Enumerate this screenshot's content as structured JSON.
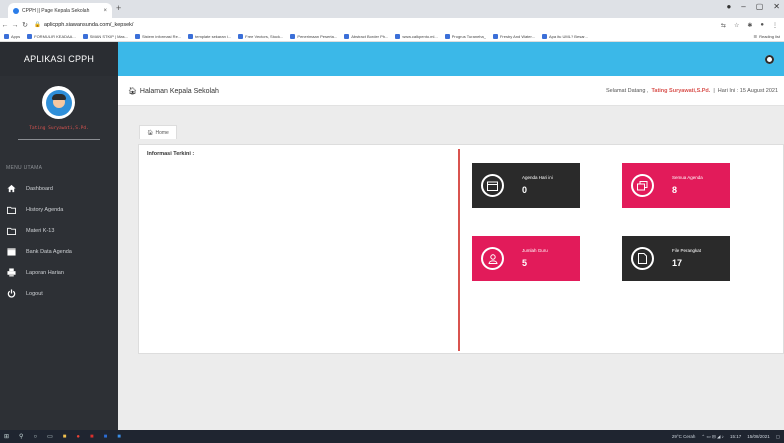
{
  "browser": {
    "tab_title": "CPPH || Page Kepala Sekolah",
    "tab_close": "×",
    "new_tab": "+",
    "url": "aplicpph.siawansunda.com/_kepsek/",
    "bookmarks": [
      "Apps",
      "FORMULIR KEADAA...",
      "SMAN STKIP | Mas...",
      "Sistem informasi Re...",
      "template sekaran i...",
      "Free Vectors, Stock...",
      "Penerimaan Peserta...",
      "Abstract Border Ph...",
      "www.calkpento.ml...",
      "Progrus Turaneha_",
      "Fresby And Water...",
      "Apa itu UML? Besar..."
    ],
    "reading_list": "Reading list"
  },
  "app": {
    "brand": "APLIKASI CPPH",
    "user_name": "Tating Suryawati,S.Pd.",
    "menu_title": "MENU UTAMA",
    "menu": [
      {
        "label": "Dashboard",
        "icon": "home-icon"
      },
      {
        "label": "History Agenda",
        "icon": "folder-icon"
      },
      {
        "label": "Materi K-13",
        "icon": "folder-icon"
      },
      {
        "label": "Bank Data Agenda",
        "icon": "calendar-icon"
      },
      {
        "label": "Laporan Harian",
        "icon": "print-icon"
      },
      {
        "label": "Logout",
        "icon": "power-icon"
      }
    ],
    "page_title": "Halaman Kepala Sekolah",
    "welcome_prefix": "Selamat Datang ,",
    "welcome_name": "Tating Suryawati,S.Pd.",
    "date_text": "Hari Ini : 15 August 2021",
    "breadcrumb": "Home",
    "info_title": "Informasi Terkini :",
    "cards": [
      {
        "label": "Agenda Hari ini",
        "value": "0",
        "color": "#2a2a2a"
      },
      {
        "label": "Semua Agenda",
        "value": "8",
        "color": "#e21b5a"
      },
      {
        "label": "Jumlah Guru",
        "value": "5",
        "color": "#e21b5a"
      },
      {
        "label": "File Perangkat",
        "value": "17",
        "color": "#2a2a2a"
      }
    ]
  },
  "taskbar": {
    "weather": "29°C Cerah",
    "time": "15:17",
    "date": "15/08/2021"
  }
}
